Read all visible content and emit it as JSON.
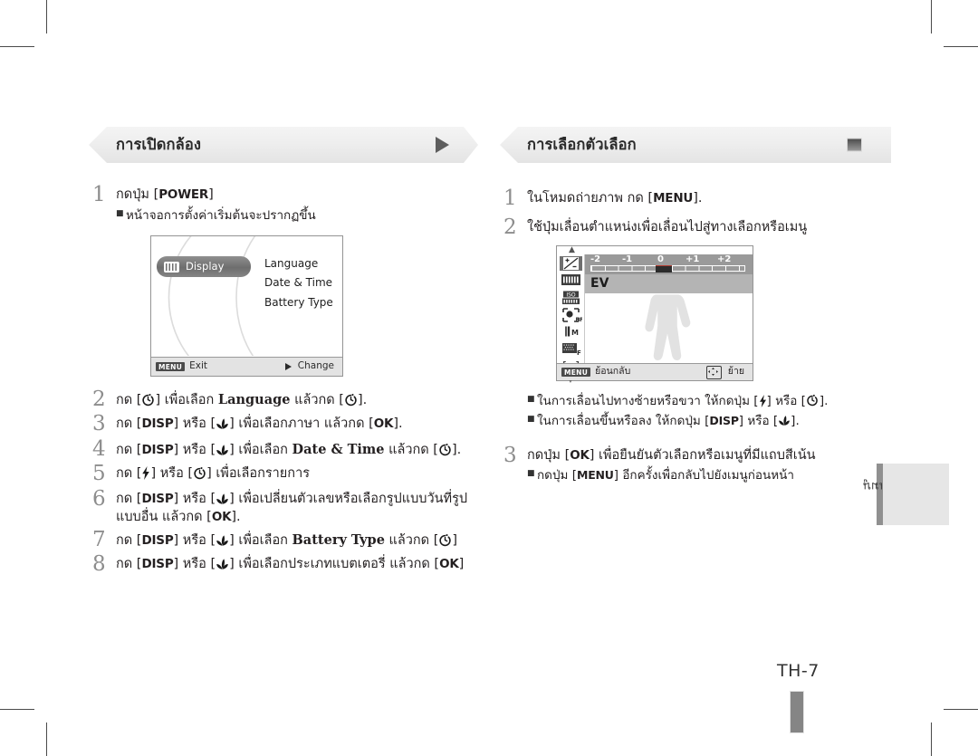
{
  "page": {
    "number": "TH-7",
    "side_tab_label": "เมนู"
  },
  "left_column": {
    "banner": {
      "title": "การเปิดกล้อง",
      "marker": "play-triangle"
    },
    "steps": [
      {
        "num": "1",
        "text": "กดปุ่ม [POWER]",
        "key": "POWER",
        "prefix": "กดปุ่ม [",
        "suffix": "]",
        "subs": [
          "หน้าจอการตั้งค่าเริ่มต้นจะปรากฏขึ้น"
        ]
      },
      {
        "num": "2",
        "parts": [
          "กด [",
          "] เพื่อเลือก ",
          "Language",
          " แล้วกด [",
          "]."
        ],
        "icons": [
          "timer-icon",
          "timer-icon"
        ]
      },
      {
        "num": "3",
        "parts": [
          "กด [",
          "DISP",
          "] หรือ [",
          "] เพื่อเลือกภาษา แล้วกด [",
          "OK",
          "]."
        ],
        "icons": [
          "macro-icon"
        ]
      },
      {
        "num": "4",
        "parts": [
          "กด [",
          "DISP",
          "] หรือ [",
          "] เพื่อเลือก ",
          "Date & Time",
          " แล้วกด [",
          "]."
        ],
        "icons": [
          "macro-icon",
          "timer-icon"
        ]
      },
      {
        "num": "5",
        "parts": [
          "กด [",
          "] หรือ [",
          "] เพื่อเลือกรายการ"
        ],
        "icons": [
          "flash-icon",
          "timer-icon"
        ]
      },
      {
        "num": "6",
        "parts": [
          "กด [",
          "DISP",
          "] หรือ [",
          "] เพื่อเปลี่ยนตัวเลขหรือเลือกรูปแบบวันที่รูปแบบอื่น แล้วกด [",
          "OK",
          "]."
        ],
        "icons": [
          "macro-icon"
        ]
      },
      {
        "num": "7",
        "parts": [
          "กด [",
          "DISP",
          "] หรือ [",
          "] เพื่อเลือก ",
          "Battery Type",
          " แล้วกด [",
          "]"
        ],
        "icons": [
          "macro-icon",
          "timer-icon"
        ]
      },
      {
        "num": "8",
        "parts": [
          "กด [",
          "DISP",
          "] หรือ [",
          "] เพื่อเลือกประเภทแบตเตอรี่ แล้วกด [",
          "OK",
          "]"
        ],
        "icons": [
          "macro-icon"
        ]
      }
    ],
    "lcd_setup": {
      "tab_label": "Display",
      "tab_icon": "display-icon",
      "menu_items": [
        "Language",
        "Date & Time",
        "Battery Type"
      ],
      "footer": {
        "menu_chip": "MENU",
        "left_label": "Exit",
        "right_label": "Change",
        "right_icon": "triangle-right-icon"
      }
    }
  },
  "right_column": {
    "banner": {
      "title": "การเลือกตัวเลือก",
      "marker": "square"
    },
    "steps": [
      {
        "num": "1",
        "prefix": "ในโหมดถ่ายภาพ กด [",
        "key": "MENU",
        "suffix": "]."
      },
      {
        "num": "2",
        "text": "ใช้ปุ่มเลื่อนตำแหน่งเพื่อเลื่อนไปสู่ทางเลือกหรือเมนู",
        "subs": [
          {
            "parts": [
              "ในการเลื่อนไปทางซ้ายหรือขวา ให้กดปุ่ม [",
              "] หรือ [",
              "]."
            ],
            "icons": [
              "flash-icon",
              "timer-icon"
            ]
          },
          {
            "parts": [
              "ในการเลื่อนขึ้นหรือลง ให้กดปุ่ม [",
              "DISP",
              "] หรือ [",
              "]."
            ],
            "icons": [
              "macro-icon"
            ]
          }
        ]
      },
      {
        "num": "3",
        "parts": [
          "กดปุ่ม [",
          "OK",
          "] เพื่อยืนยันตัวเลือกหรือเมนูที่มีแถบสีเน้น"
        ],
        "subs": [
          {
            "parts": [
              "กดปุ่ม [",
              "MENU",
              "] อีกครั้งเพื่อกลับไปยังเมนูก่อนหน้า"
            ]
          }
        ]
      }
    ],
    "lcd_ev": {
      "label": "EV",
      "scale_ticks": [
        "-2",
        "-1",
        "0",
        "+1",
        "+2"
      ],
      "sidebar_icons": [
        "exposure-value-icon",
        "auto-white-balance-icon",
        "iso-auto-icon",
        "face-detection-off-icon",
        "image-size-icon",
        "image-quality-fine-icon",
        "metering-spot-icon"
      ],
      "footer": {
        "menu_chip": "MENU",
        "left_label": "ย้อนกลับ",
        "right_label": "ย้าย",
        "right_icon": "dpad-icon"
      }
    }
  }
}
